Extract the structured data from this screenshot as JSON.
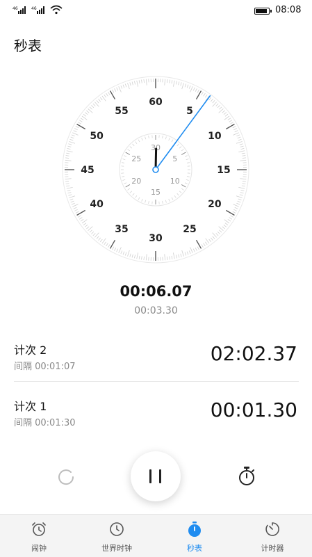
{
  "status_bar": {
    "signal_1": "⁴⁶",
    "signal_2": "⁴⁶",
    "time": "08:08"
  },
  "header": {
    "title": "秒表"
  },
  "dial": {
    "outer_labels": [
      "60",
      "5",
      "10",
      "15",
      "20",
      "25",
      "30",
      "35",
      "40",
      "45",
      "50",
      "55"
    ],
    "inner_labels": [
      "30",
      "5",
      "10",
      "15",
      "20",
      "25"
    ],
    "second_hand_seconds": 6.07,
    "minute_hand_value": 0.1,
    "accent_color": "#1f8cf0"
  },
  "timer": {
    "main": "00:06.07",
    "current_lap": "00:03.30"
  },
  "laps": [
    {
      "name": "计次 2",
      "interval": "间隔 00:01:07",
      "total": "02:02.37"
    },
    {
      "name": "计次 1",
      "interval": "间隔 00:01:30",
      "total": "00:01.30"
    }
  ],
  "controls": {
    "reset": "reset-icon",
    "pause": "pause-icon",
    "lap": "stopwatch-lap-icon"
  },
  "tabs": [
    {
      "label": "闹钟",
      "icon": "alarm-icon",
      "active": false
    },
    {
      "label": "世界时钟",
      "icon": "world-clock-icon",
      "active": false
    },
    {
      "label": "秒表",
      "icon": "stopwatch-icon",
      "active": true
    },
    {
      "label": "计时器",
      "icon": "timer-icon",
      "active": false
    }
  ]
}
